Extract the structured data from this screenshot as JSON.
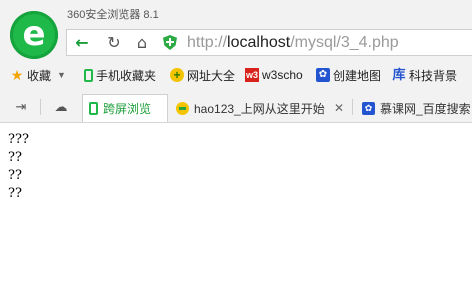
{
  "browser": {
    "name_version": "360安全浏览器 8.1",
    "logo_letter": "e"
  },
  "navbar": {
    "back_icon": "←",
    "refresh_icon": "↻",
    "home_icon": "⌂",
    "url_scheme": "http://",
    "url_host": "localhost",
    "url_path": "/mysql/3_4.php"
  },
  "bookmarks": [
    {
      "label": "收藏",
      "icon": "star-icon"
    },
    {
      "label": "手机收藏夹",
      "icon": "phone-icon"
    },
    {
      "label": "网址大全",
      "icon": "plus-icon"
    },
    {
      "label": "w3scho",
      "icon": "w3-icon"
    },
    {
      "label": "创建地图",
      "icon": "baidu-paw-icon"
    },
    {
      "label": "科技背景",
      "icon": "ku-icon"
    }
  ],
  "tabs": [
    {
      "label": "跨屏浏览",
      "icon": "phone-icon",
      "active": true
    },
    {
      "label": "hao123_上网从这里开始",
      "icon": "hao123-icon",
      "close": "✕"
    },
    {
      "label": "慕课网_百度搜索",
      "icon": "baidu-paw-icon"
    }
  ],
  "page_lines": [
    "???",
    "??",
    "??",
    "??"
  ],
  "colors": {
    "accent": "#1a9e3a",
    "chrome_bg": "#f2f2f2"
  }
}
